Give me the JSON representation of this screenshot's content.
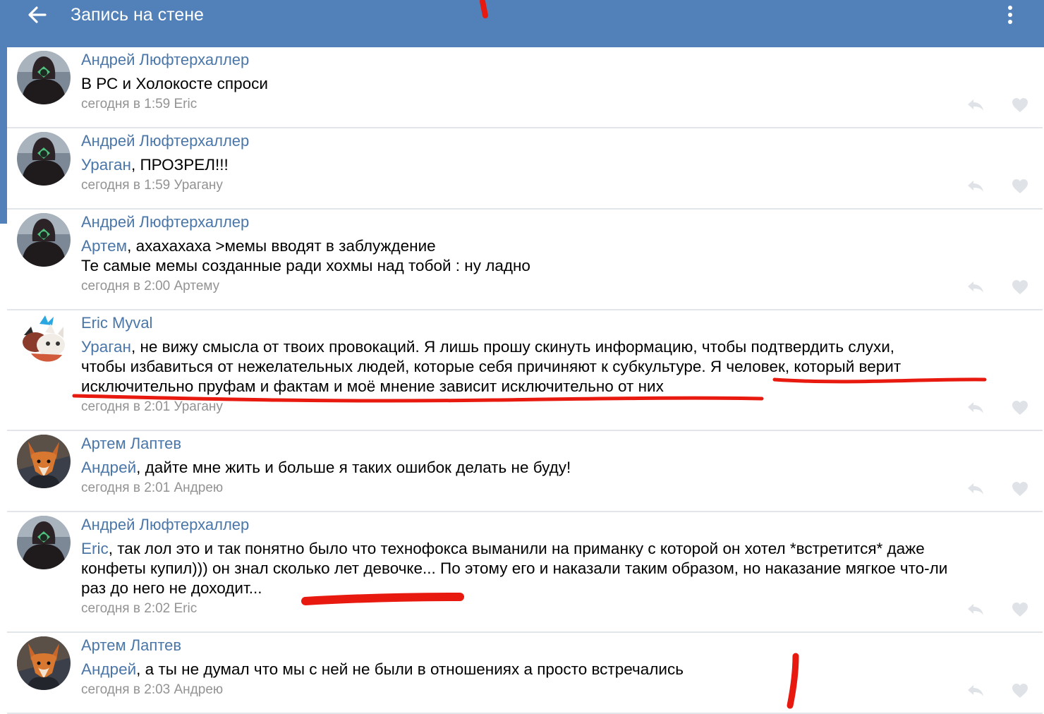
{
  "header": {
    "title": "Запись на стене",
    "background": "#5181b8",
    "back_icon": "arrow-left-icon",
    "menu_icon": "more-vertical-icon"
  },
  "colors": {
    "author": "#4a76a8",
    "meta": "#939393",
    "divider": "#e2e5e9",
    "annotation": "#e8190f"
  },
  "comments": [
    {
      "author": "Андрей Люфтерхаллер",
      "avatar": "hooded-figure-avatar",
      "mention": "",
      "lines": [
        "В РС и Холокосте спроси"
      ],
      "meta": "сегодня в 1:59 Eric"
    },
    {
      "author": "Андрей Люфтерхаллер",
      "avatar": "hooded-figure-avatar",
      "mention": "Ураган",
      "lines": [
        ", ПРОЗРЕЛ!!!"
      ],
      "meta": "сегодня в 1:59 Урагану"
    },
    {
      "author": "Андрей Люфтерхаллер",
      "avatar": "hooded-figure-avatar",
      "mention": "Артем",
      "lines": [
        ", ахахахаха >мемы вводят в заблуждение",
        "Те самые мемы созданные ради хохмы над тобой : ну ладно"
      ],
      "meta": "сегодня в 2:00 Артему"
    },
    {
      "author": "Eric Myval",
      "avatar": "cartoon-fox-avatar",
      "mention": "Ураган",
      "lines": [
        ", не вижу смысла от твоих провокаций. Я лишь прошу скинуть информацию, чтобы подтвердить слухи,",
        "чтобы избавиться от нежелательных людей, которые себя причиняют к субкультуре. Я человек, который верит",
        "исключительно пруфам и фактам и моё мнение зависит исключительно от них"
      ],
      "meta": "сегодня в 2:01 Урагану"
    },
    {
      "author": "Артем Лаптев",
      "avatar": "fox-portrait-avatar",
      "mention": "Андрей",
      "lines": [
        ", дайте мне жить и больше я таких ошибок делать не буду!"
      ],
      "meta": "сегодня в 2:01 Андрею"
    },
    {
      "author": "Андрей Люфтерхаллер",
      "avatar": "hooded-figure-avatar",
      "mention": "Eric",
      "lines": [
        ", так лол это и так понятно было что технофокса выманили на приманку с которой он хотел *встретится* даже",
        "конфеты купил))) он знал сколько лет девочке... По этому его и наказали таким образом, но наказание мягкое что-ли",
        "раз до него не доходит..."
      ],
      "meta": "сегодня в 2:02 Eric"
    },
    {
      "author": "Артем Лаптев",
      "avatar": "fox-portrait-avatar",
      "mention": "Андрей",
      "lines": [
        ", а ты не думал что мы с ней не были в отношениях а просто встречались"
      ],
      "meta": "сегодня в 2:03 Андрею"
    }
  ]
}
